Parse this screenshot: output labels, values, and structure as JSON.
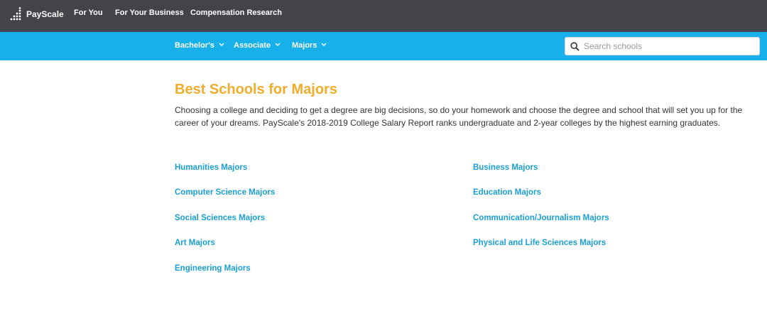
{
  "brand": {
    "name": "PayScale",
    "logo_icon": "payscale-dots-logo"
  },
  "top_nav": [
    {
      "label": "For You"
    },
    {
      "label": "For Your Business"
    },
    {
      "label": "Compensation Research"
    }
  ],
  "sub_nav": [
    {
      "label": "Bachelor's",
      "icon": "chevron-down-icon"
    },
    {
      "label": "Associate",
      "icon": "chevron-down-icon"
    },
    {
      "label": "Majors",
      "icon": "chevron-down-icon"
    }
  ],
  "search": {
    "placeholder": "Search schools",
    "value": "",
    "icon": "search-icon"
  },
  "main": {
    "title": "Best Schools for Majors",
    "intro": "Choosing a college and deciding to get a degree are big decisions, so do your homework and choose the degree and school that will set you up for the career of your dreams. PayScale's 2018-2019 College Salary Report ranks undergraduate and 2-year colleges by the highest earning graduates.",
    "links_left": [
      "Humanities Majors",
      "Computer Science Majors",
      "Social Sciences Majors",
      "Art Majors",
      "Engineering Majors"
    ],
    "links_right": [
      "Business Majors",
      "Education Majors",
      "Communication/Journalism Majors",
      "Physical and Life Sciences Majors"
    ]
  },
  "colors": {
    "top_bar": "#434349",
    "sub_bar": "#17b0ea",
    "title": "#f0ad2b",
    "link": "#1aa0d6",
    "text": "#333333"
  }
}
